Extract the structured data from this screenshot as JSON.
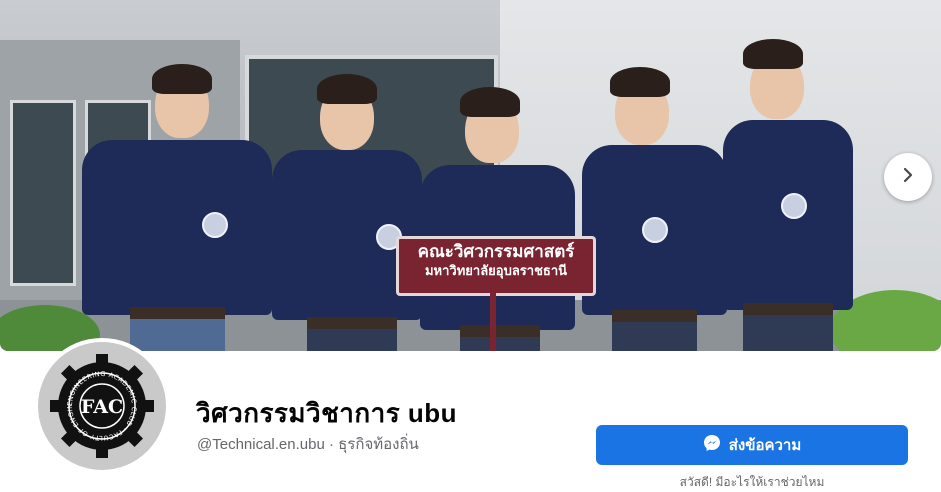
{
  "cover": {
    "sign_line1": "คณะวิศวกรรมศาสตร์",
    "sign_line2": "มหาวิทยาลัยอุบลราชธานี",
    "next_icon": "chevron-right-icon"
  },
  "profile": {
    "avatar_logo_text": "FAC",
    "avatar_ring_text": "ENGINEERING ACADEMIC CLUB · FACULTY OF ENGINEERING",
    "name": "วิศวกรรมวิชาการ ubu",
    "username": "@Technical.en.ubu",
    "separator": "·",
    "category": "ธุรกิจท้องถิ่น"
  },
  "actions": {
    "send_message_label": "ส่งข้อความ",
    "send_message_icon": "messenger-icon",
    "button_color": "#1b74e4",
    "greeting": "สวัสดี! มีอะไรให้เราช่วยไหม"
  }
}
